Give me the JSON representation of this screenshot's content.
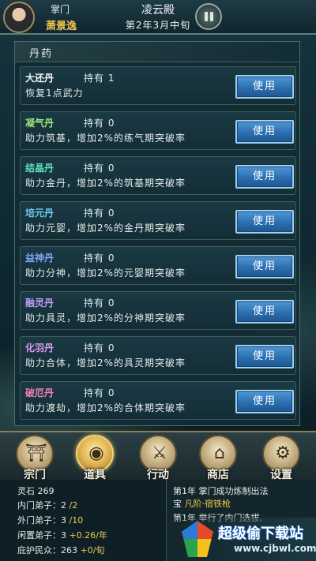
{
  "header": {
    "role": "掌门",
    "player_name": "萧景逸",
    "location": "凌云殿",
    "date": "第2年3月中旬"
  },
  "panel": {
    "title": "丹药",
    "items": [
      {
        "name": "大还丹",
        "held": "持有 1",
        "desc": "恢复1点武力",
        "use_label": "使用",
        "name_color": "#f4f6f4"
      },
      {
        "name": "凝气丹",
        "held": "持有 0",
        "desc": "助力筑基，增加2%的练气期突破率",
        "use_label": "使用",
        "name_color": "#9be07a"
      },
      {
        "name": "结晶丹",
        "held": "持有 0",
        "desc": "助力金丹，增加2%的筑基期突破率",
        "use_label": "使用",
        "name_color": "#5fe0b9"
      },
      {
        "name": "培元丹",
        "held": "持有 0",
        "desc": "助力元婴，增加2%的金丹期突破率",
        "use_label": "使用",
        "name_color": "#6fc6f0"
      },
      {
        "name": "益神丹",
        "held": "持有 0",
        "desc": "助力分神，增加2%的元婴期突破率",
        "use_label": "使用",
        "name_color": "#7fa4f0"
      },
      {
        "name": "融灵丹",
        "held": "持有 0",
        "desc": "助力具灵，增加2%的分神期突破率",
        "use_label": "使用",
        "name_color": "#b99af0"
      },
      {
        "name": "化羽丹",
        "held": "持有 0",
        "desc": "助力合体，增加2%的具灵期突破率",
        "use_label": "使用",
        "name_color": "#d79af0"
      },
      {
        "name": "破厄丹",
        "held": "持有 0",
        "desc": "助力渡劫，增加2%的合体期突破率",
        "use_label": "使用",
        "name_color": "#f07fb4"
      }
    ]
  },
  "nav": [
    {
      "label": "宗门",
      "icon": "sect-gate-icon",
      "glyph": "⛩"
    },
    {
      "label": "道具",
      "icon": "pouch-icon",
      "glyph": "◉"
    },
    {
      "label": "行动",
      "icon": "sword-icon",
      "glyph": "⚔"
    },
    {
      "label": "商店",
      "icon": "shop-icon",
      "glyph": "⌂"
    },
    {
      "label": "设置",
      "icon": "gear-icon",
      "glyph": "⚙"
    }
  ],
  "stats": {
    "spirit_stones_label": "灵石",
    "spirit_stones": "269",
    "inner_disciples_label": "内门弟子：",
    "inner_disciples": "2",
    "inner_disciples_max": "/2",
    "outer_disciples_label": "外门弟子：",
    "outer_disciples": "3",
    "outer_disciples_max": "/10",
    "idle_disciples_label": "闲置弟子：",
    "idle_disciples": "3",
    "idle_rate": "+0.26/年",
    "protected_label": "庇护民众：",
    "protected": "263",
    "protected_rate": "+0/旬"
  },
  "log": {
    "line1": "第1年  掌门成功炼制出法",
    "line2_prefix": "宝",
    "line2_item": "凡阶·宿铁枪",
    "line3": "第1年  举行了内门选拔,"
  },
  "watermark": {
    "title": "超级偷下载站",
    "url": "www.cjbwl.com"
  },
  "colors": {
    "accent_gold": "#f0c54a",
    "button_blue": "#2b6fb0"
  }
}
